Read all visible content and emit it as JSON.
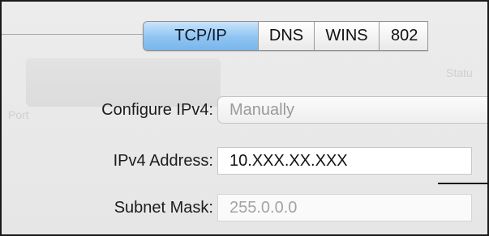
{
  "tabs": [
    {
      "label": "TCP/IP",
      "active": true
    },
    {
      "label": "DNS",
      "active": false
    },
    {
      "label": "WINS",
      "active": false
    },
    {
      "label": "802",
      "active": false
    }
  ],
  "background_window": {
    "status_text": "Statu",
    "port_text": "Port"
  },
  "form": {
    "configure_ipv4": {
      "label": "Configure IPv4:",
      "value": "Manually"
    },
    "ipv4_address": {
      "label": "IPv4 Address:",
      "value": "10.XXX.XX.XXX"
    },
    "subnet_mask": {
      "label": "Subnet Mask:",
      "value": "255.0.0.0"
    }
  },
  "colors": {
    "active_tab": "#8fc4f2",
    "border": "#1a1a1a"
  }
}
